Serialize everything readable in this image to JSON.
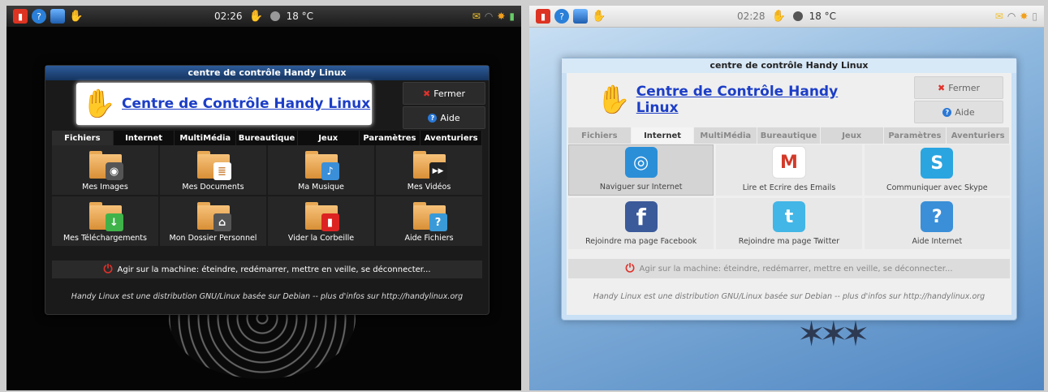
{
  "left": {
    "clock": "02:26",
    "weather": "18 °C",
    "window_title": "centre de contrôle Handy Linux",
    "logo_text": "Centre de Contrôle Handy Linux",
    "close_label": "Fermer",
    "help_label": "Aide",
    "tabs": [
      "Fichiers",
      "Internet",
      "MultiMédia",
      "Bureautique",
      "Jeux",
      "Paramètres",
      "Aventuriers"
    ],
    "active_tab": "Fichiers",
    "items": [
      "Mes Images",
      "Mes Documents",
      "Ma Musique",
      "Mes Vidéos",
      "Mes Téléchargements",
      "Mon Dossier Personnel",
      "Vider la Corbeille",
      "Aide Fichiers"
    ],
    "action": "Agir sur la machine: éteindre, redémarrer, mettre en veille, se déconnecter...",
    "footer": "Handy Linux est une distribution GNU/Linux basée sur Debian -- plus d'infos sur http://handylinux.org"
  },
  "right": {
    "clock": "02:28",
    "weather": "18 °C",
    "window_title": "centre de contrôle Handy Linux",
    "logo_text": "Centre de Contrôle Handy Linux",
    "close_label": "Fermer",
    "help_label": "Aide",
    "tabs": [
      "Fichiers",
      "Internet",
      "MultiMédia",
      "Bureautique",
      "Jeux",
      "Paramètres",
      "Aventuriers"
    ],
    "active_tab": "Internet",
    "items": [
      "Naviguer sur Internet",
      "Lire et Ecrire des Emails",
      "Communiquer avec Skype",
      "Rejoindre ma page Facebook",
      "Rejoindre ma page Twitter",
      "Aide Internet"
    ],
    "action": "Agir sur la machine: éteindre, redémarrer, mettre en veille, se déconnecter...",
    "footer": "Handy Linux est une distribution GNU/Linux basée sur Debian -- plus d'infos sur http://handylinux.org"
  },
  "icons": [
    "trash-icon",
    "help-icon",
    "screen-icon",
    "handy-hand-icon",
    "moon-icon",
    "mail-icon",
    "wifi-icon",
    "sun-icon",
    "battery-icon"
  ],
  "colors": {
    "accent_blue": "#1c3ec7",
    "close_red": "#e0312a",
    "folder_orange": "#e9a955"
  }
}
